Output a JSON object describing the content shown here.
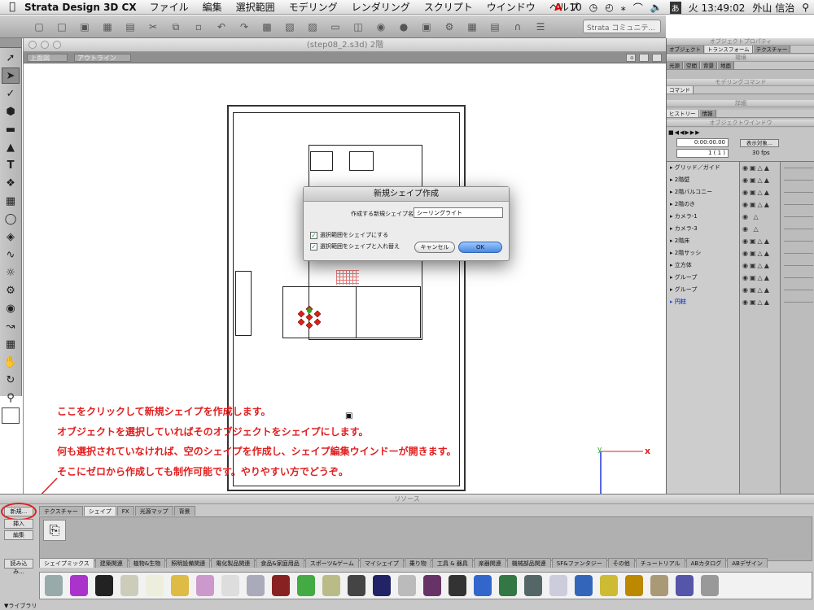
{
  "menubar": {
    "app_name": "Strata Design 3D CX",
    "items": [
      "ファイル",
      "編集",
      "選択範囲",
      "モデリング",
      "レンダリング",
      "スクリプト",
      "ウインドウ",
      "ヘルプ"
    ],
    "adobe_count": "10",
    "clock": "火 13:49:02",
    "user": "外山 信治"
  },
  "toolbar": {
    "combo_text": "Strata コミュニテ..."
  },
  "document": {
    "title": "(step08_2.s3d) 2階",
    "view_dropdown": "上面図",
    "render_dropdown": "アウトライン"
  },
  "dialog": {
    "title": "新規シェイプ作成",
    "name_label": "作成する新規シェイプ名:",
    "name_value": "シーリングライト",
    "check1": "選択範囲をシェイプにする",
    "check2": "選択範囲をシェイプと入れ替え",
    "cancel": "キャンセル",
    "ok": "OK"
  },
  "right_panel": {
    "object_props_title": "オブジェクトプロパティ",
    "props_tabs": [
      "オブジェクト",
      "トランスフォーム",
      "テクスチャー"
    ],
    "environment_title": "環境",
    "env_tabs": [
      "光源",
      "空間",
      "背景",
      "地面"
    ],
    "modeling_title": "モデリングコマンド",
    "modeling_tabs": [
      "コマンド"
    ],
    "detail_title": "詳細",
    "detail_tabs": [
      "ヒストリー",
      "情報"
    ],
    "object_window_title": "オブジェクトウインドウ",
    "timecode": "0:00:00.00",
    "frame": "1 ( 1 )",
    "display_button": "表示対象...",
    "fps": "30 fps",
    "layers": [
      "グリッド／ガイド",
      "2階壁",
      "2階バルコニー",
      "2階のき",
      "カメラ-1",
      "カメラ-3",
      "2階床",
      "2階サッシ",
      "立方体",
      "グループ",
      "グループ",
      "円柱"
    ]
  },
  "annotation": {
    "line1": "ここをクリックして新規シェイプを作成します。",
    "line2": "オブジェクトを選択していればそのオブジェクトをシェイプにします。",
    "line3": "何も選択されていなければ、空のシェイプを作成し、シェイプ編集ウインドーが開きます。",
    "line4": "そこにゼロから作成しても制作可能です。やりやすい方でどうぞ。"
  },
  "coord_axes": {
    "x_label": "x",
    "y_label": "y"
  },
  "resources": {
    "title": "リソース",
    "side_buttons": [
      "新規...",
      "挿入",
      "編集",
      "読み込み..."
    ],
    "tabs": [
      "テクスチャー",
      "シェイプ",
      "FX",
      "光源マップ",
      "背景"
    ],
    "library_tabs": [
      "シェイプミックス",
      "建築関連",
      "植物&生物",
      "照明設備関連",
      "電化製品関連",
      "食品&家庭用品",
      "スポーツ&ゲーム",
      "マイシェイプ",
      "乗り物",
      "工具 & 器具",
      "楽器関連",
      "機械部品関連",
      "SF&ファンタジー",
      "その他",
      "チュートリアル",
      "ABカタログ",
      "ABデザイン"
    ],
    "library_label": "ライブラリ"
  },
  "colors": {
    "annotation": "#e02020",
    "ok_button": "#5b9be8",
    "selected_layer": "#2848c8"
  }
}
